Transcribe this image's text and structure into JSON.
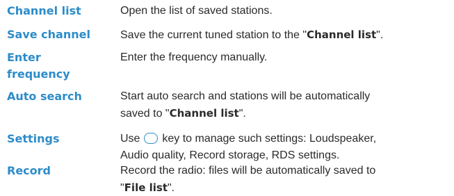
{
  "rows": [
    {
      "term": "Channel list",
      "desc": [
        "Open the list of saved stations."
      ]
    },
    {
      "term": "Save channel",
      "desc_pre": "Save the current tuned station to the \"",
      "desc_bold": "Channel list",
      "desc_post": "\"."
    },
    {
      "term_line1": "Enter",
      "term_line2": "frequency",
      "desc": [
        "Enter the frequency manually."
      ]
    },
    {
      "term": "Auto search",
      "desc_line1": "Start auto search and stations will be automatically",
      "desc_line2_pre": "saved to \"",
      "desc_line2_bold": "Channel list",
      "desc_line2_post": "\"."
    },
    {
      "term": "Settings",
      "desc_line1_pre": "Use ",
      "desc_line1_icon": "options-key-icon",
      "desc_line1_post": " key to manage such settings: Loudspeaker,",
      "desc_line2": "Audio quality, Record storage, RDS settings."
    },
    {
      "term": "Record",
      "desc_line1": "Record the radio: files will be automatically saved to",
      "desc_line2_pre": "\"",
      "desc_line2_bold": "File list",
      "desc_line2_post": "\"."
    }
  ],
  "colors": {
    "term": "#2d8cc9",
    "text": "#2a2a2a",
    "icon_outline": "#2d8cc9"
  }
}
